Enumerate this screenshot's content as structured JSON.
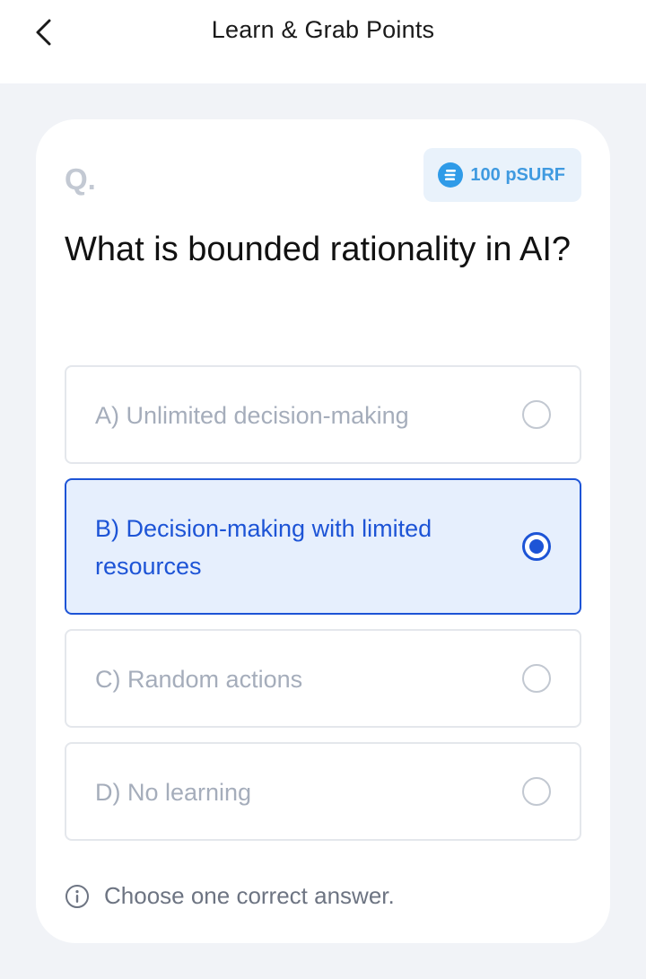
{
  "header": {
    "title": "Learn & Grab Points",
    "back_icon": "chevron-left-icon"
  },
  "question": {
    "label": "Q.",
    "text": "What is bounded rationality in AI?",
    "reward": {
      "icon": "psurf-coin-icon",
      "text": "100 pSURF"
    }
  },
  "options": [
    {
      "label": "A) Unlimited decision-making",
      "selected": false
    },
    {
      "label": "B) Decision-making with limited resources",
      "selected": true
    },
    {
      "label": "C) Random actions",
      "selected": false
    },
    {
      "label": "D) No learning",
      "selected": false
    }
  ],
  "hint": {
    "icon": "info-icon",
    "text": "Choose one correct answer."
  },
  "colors": {
    "accent": "#1d54d6",
    "selected_bg": "#e6effd",
    "badge_bg": "#e9f2fb",
    "badge_text": "#3f9ae0",
    "page_bg": "#f1f3f7"
  }
}
